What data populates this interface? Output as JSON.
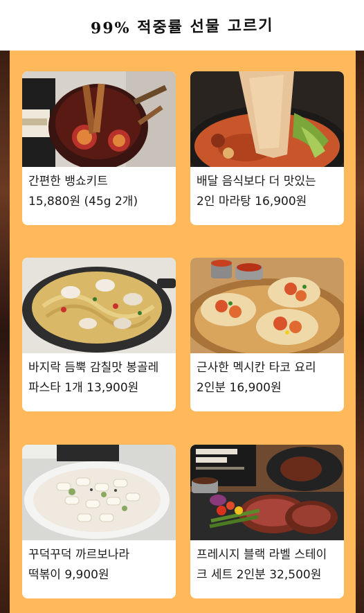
{
  "header": {
    "title": "99% 적중률 선물 고르기"
  },
  "products": [
    {
      "line1": "간편한 뱅쇼키트",
      "line2": "15,880원 (45g 2개)",
      "image": "mulled-wine-kit-image"
    },
    {
      "line1": "배달 음식보다 더 맛있는",
      "line2": "2인 마라탕 16,900원",
      "image": "malatang-image"
    },
    {
      "line1": "바지락 듬뿍 감칠맛 봉골레",
      "line2": "파스타 1개 13,900원",
      "image": "vongole-pasta-image"
    },
    {
      "line1": "근사한 멕시칸 타코 요리",
      "line2": "2인분 16,900원",
      "image": "mexican-taco-image"
    },
    {
      "line1": "꾸덕꾸덕 까르보나라",
      "line2": "떡볶이 9,900원",
      "image": "carbonara-tteokbokki-image"
    },
    {
      "line1": "프레시지 블랙 라벨 스테이",
      "line2": "크 세트 2인분 32,500원",
      "image": "black-label-steak-image"
    }
  ]
}
